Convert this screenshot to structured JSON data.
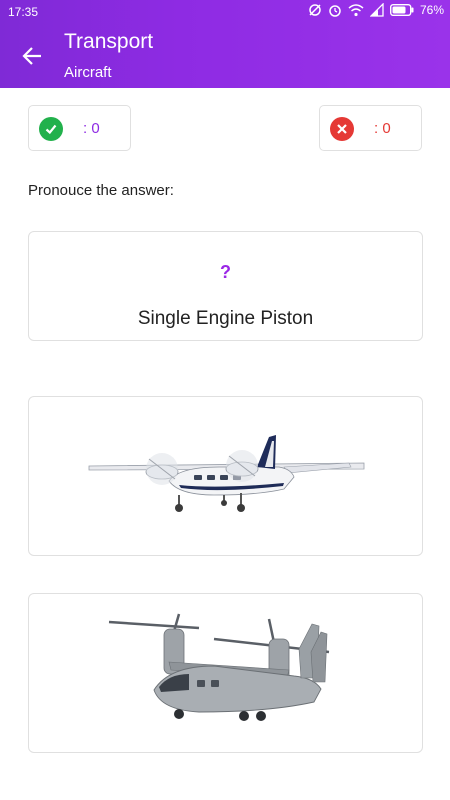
{
  "status_bar": {
    "time": "17:35",
    "battery": "76%",
    "icons": [
      "sync-off-icon",
      "alarm-icon",
      "wifi-icon",
      "signal-icon",
      "battery-icon"
    ]
  },
  "app_bar": {
    "title": "Transport",
    "subtitle": "Aircraft",
    "back_icon": "arrow-back-icon"
  },
  "score": {
    "correct": ": 0",
    "wrong": ": 0"
  },
  "prompt": "Pronouce the answer:",
  "question": {
    "mark": "?",
    "answer": "Single Engine Piston"
  },
  "options": [
    {
      "image": "twin-engine-plane"
    },
    {
      "image": "tiltrotor-aircraft"
    }
  ],
  "colors": {
    "header": "#8e2be3",
    "correct": "#22b14c",
    "wrong": "#e53935",
    "accent": "#9b27e6"
  }
}
